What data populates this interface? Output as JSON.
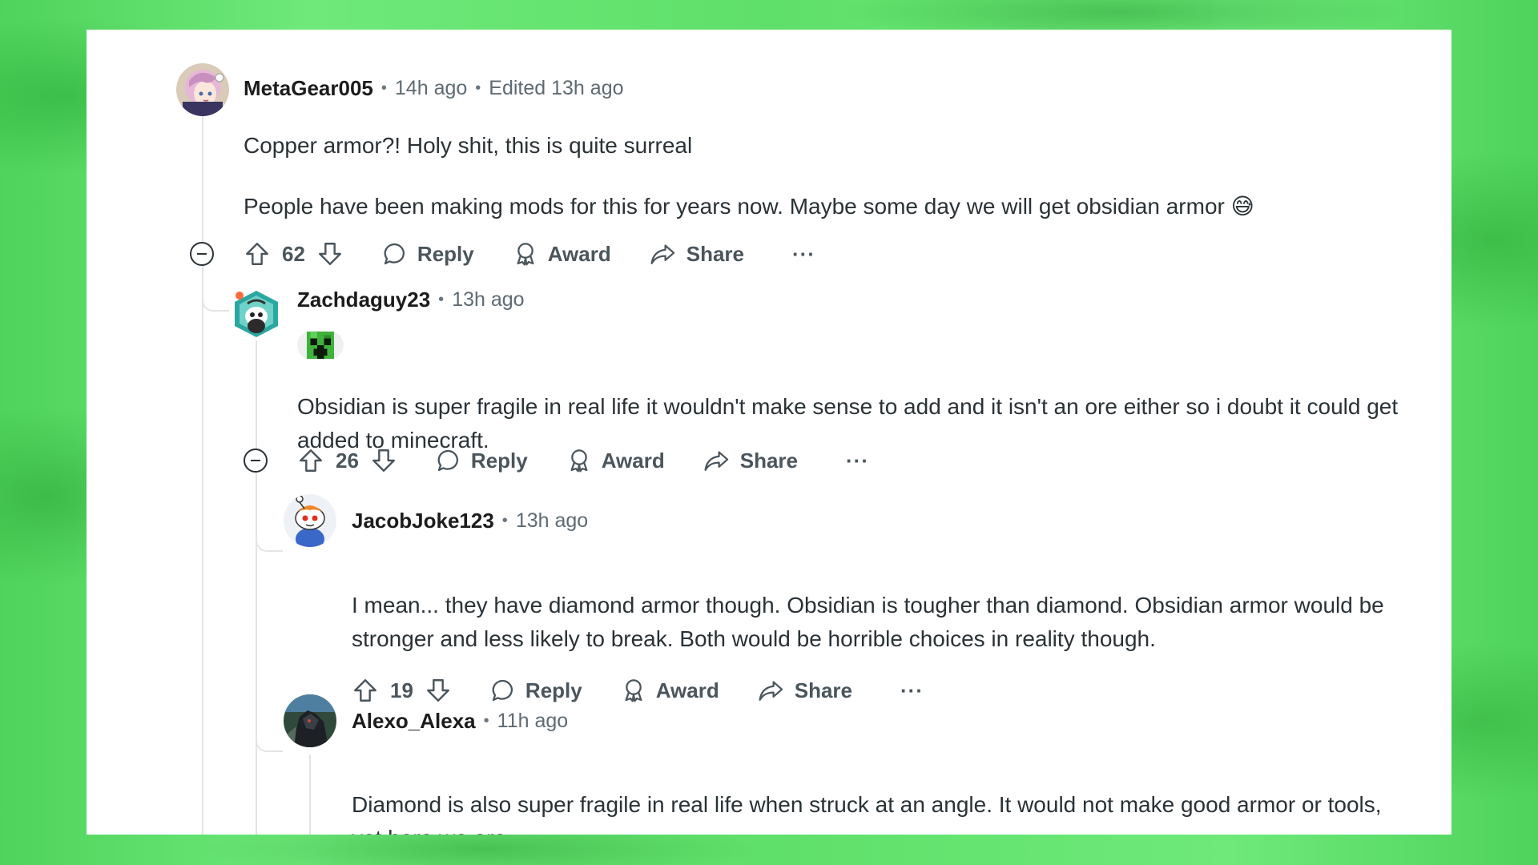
{
  "comments": [
    {
      "username": "MetaGear005",
      "time": "14h ago",
      "edited": "Edited 13h ago",
      "body": [
        "Copper armor?! Holy shit, this is quite surreal",
        "People have been making mods for this for years now. Maybe some day we will get obsidian armor 😅"
      ],
      "votes": "62",
      "avatar": "anime-girl-avatar"
    },
    {
      "username": "Zachdaguy23",
      "time": "13h ago",
      "flair": "creeper-flair-icon",
      "body": [
        "Obsidian is super fragile in real life it wouldn't make sense to add and it isn't an ore either so i doubt it could get added to minecraft."
      ],
      "votes": "26",
      "avatar": "snoo-avatar-teal"
    },
    {
      "username": "JacobJoke123",
      "time": "13h ago",
      "body": [
        "I mean... they have diamond armor though. Obsidian is tougher than diamond. Obsidian armor would be stronger and less likely to break. Both would be horrible choices in reality though."
      ],
      "votes": "19",
      "avatar": "snoo-avatar-orange"
    },
    {
      "username": "Alexo_Alexa",
      "time": "11h ago",
      "body": [
        "Diamond is also super fragile in real life when struck at an angle. It would not make good armor or tools, yet here we are."
      ],
      "avatar": "dark-armor-avatar"
    }
  ],
  "actions": {
    "reply": "Reply",
    "award": "Award",
    "share": "Share",
    "more": "···"
  },
  "colors": {
    "background_green": "#5fe06a",
    "card": "#ffffff",
    "thread_line": "#e2e4e6",
    "text": "#2a3236"
  }
}
